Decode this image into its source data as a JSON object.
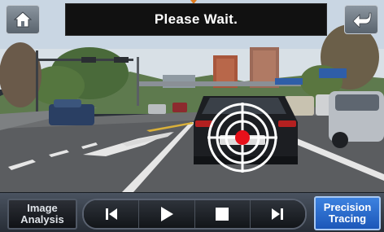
{
  "status": {
    "message": "Please Wait."
  },
  "top_bar": {
    "home_icon": "home-icon",
    "back_icon": "back-arrow-icon"
  },
  "controls": {
    "image_analysis_line1": "Image",
    "image_analysis_line2": "Analysis",
    "precision_tracing_line1": "Precision",
    "precision_tracing_line2": "Tracing",
    "transport_icons": [
      "skip-previous-icon",
      "play-icon",
      "stop-icon",
      "skip-next-icon"
    ]
  },
  "colors": {
    "accent_blue": "#2a6fd0",
    "target_red": "#e8101a",
    "banner_bg": "#111111"
  }
}
